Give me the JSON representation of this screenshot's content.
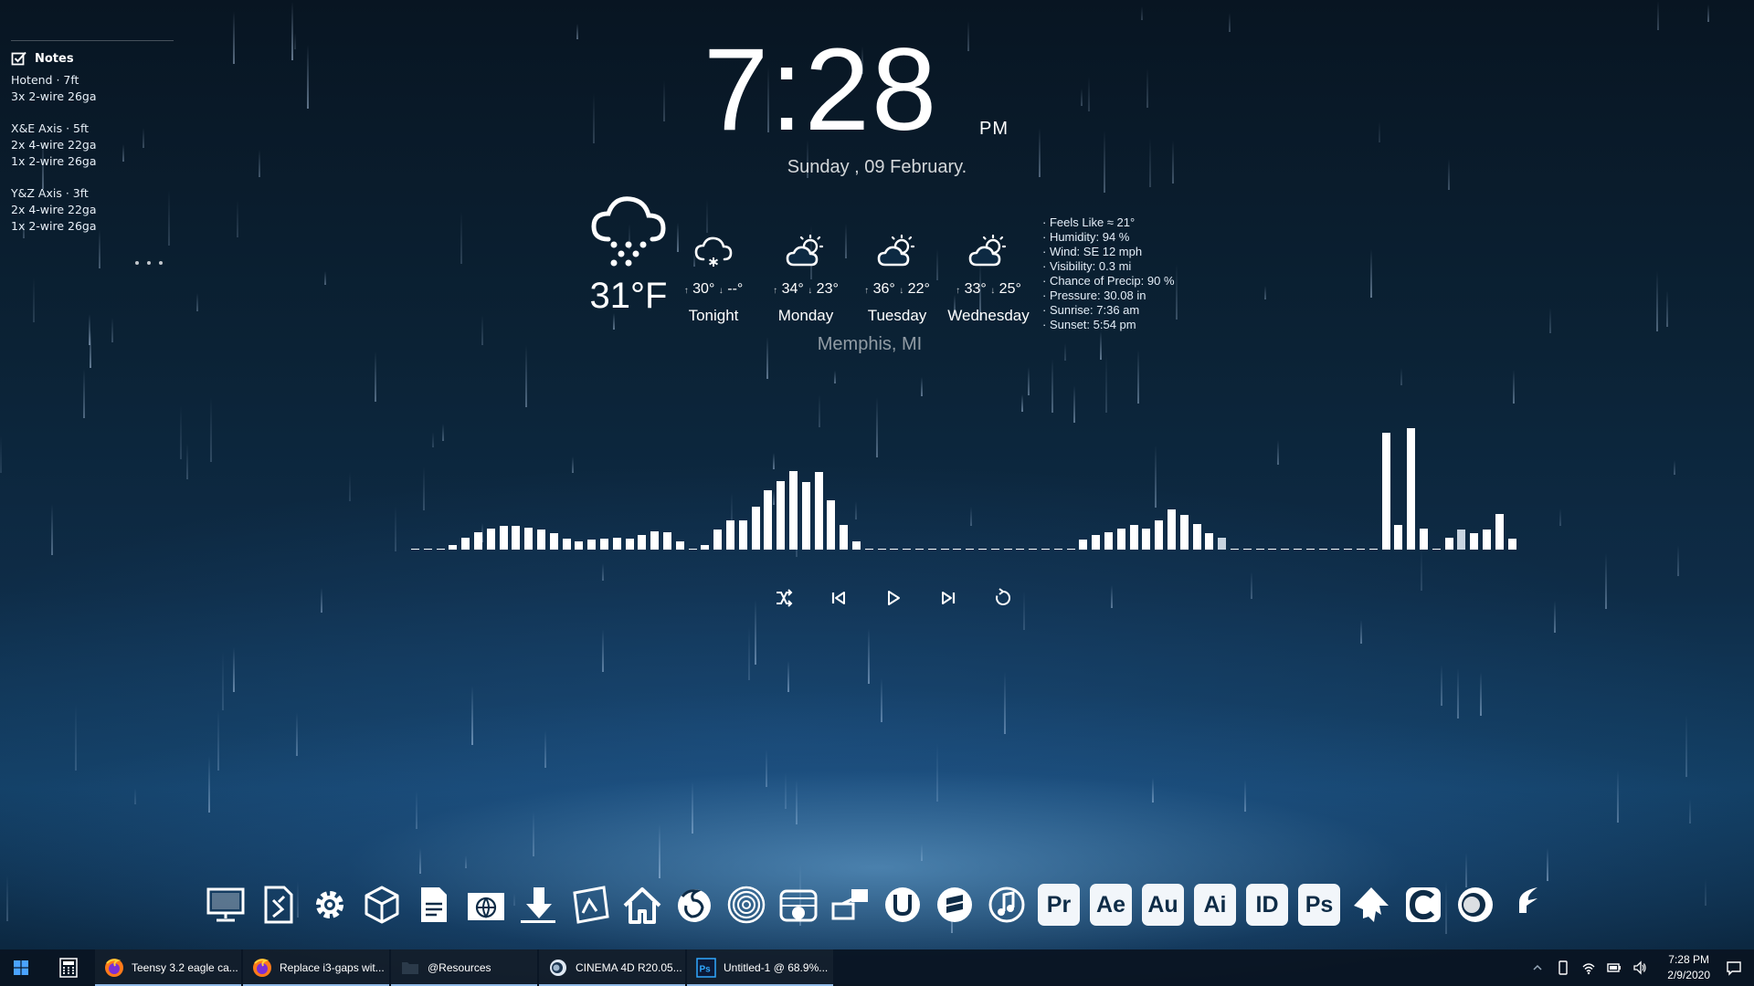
{
  "notes": {
    "title": "Notes",
    "blocks": [
      [
        "Hotend · 7ft",
        "3x 2-wire 26ga"
      ],
      [
        "X&E Axis · 5ft",
        "2x 4-wire 22ga",
        "1x 2-wire 26ga"
      ],
      [
        "Y&Z Axis · 3ft",
        "2x 4-wire 22ga",
        "1x 2-wire 26ga"
      ]
    ]
  },
  "clock": {
    "time": "7:28",
    "ampm": "PM",
    "date": "Sunday , 09 February."
  },
  "weather": {
    "current_temp": "31°F",
    "current_icon": "snow-cloud-icon",
    "forecast": [
      {
        "label": "Tonight",
        "high": "30°",
        "low": "--°",
        "icon": "snow-cloud-icon"
      },
      {
        "label": "Monday",
        "high": "34°",
        "low": "23°",
        "icon": "partly-cloudy-icon"
      },
      {
        "label": "Tuesday",
        "high": "36°",
        "low": "22°",
        "icon": "partly-cloudy-icon"
      },
      {
        "label": "Wednesday",
        "high": "33°",
        "low": "25°",
        "icon": "partly-cloudy-icon"
      }
    ],
    "city": "Memphis, MI",
    "details": [
      "· Feels Like ≈ 21°",
      "· Humidity: 94 %",
      "· Wind: SE 12 mph",
      "· Visibility: 0.3 mi",
      "· Chance of Precip: 90 %",
      "· Pressure: 30.08 in",
      "· Sunrise: 7:36 am",
      "· Sunset: 5:54 pm"
    ]
  },
  "visualizer": {
    "max": 95,
    "levels": [
      1,
      1,
      1,
      4,
      10,
      14,
      17,
      19,
      19,
      18,
      16,
      13,
      9,
      7,
      8,
      9,
      10,
      9,
      12,
      15,
      14,
      7,
      1,
      4,
      16,
      24,
      24,
      35,
      48,
      56,
      64,
      55,
      63,
      40,
      20,
      7,
      1,
      0,
      1,
      1,
      0,
      0,
      0,
      0,
      0,
      1,
      0,
      0,
      0,
      1,
      1,
      1,
      1,
      8,
      12,
      14,
      17,
      20,
      17,
      24,
      33,
      28,
      21,
      13,
      10,
      1,
      1,
      1,
      1,
      1,
      1,
      1,
      1,
      1,
      1,
      0,
      1,
      95,
      20,
      99,
      17,
      1,
      10,
      16,
      13,
      16,
      29,
      9
    ]
  },
  "media": {
    "icons": [
      "shuffle-icon",
      "previous-icon",
      "play-icon",
      "next-icon",
      "repeat-icon"
    ]
  },
  "dock": {
    "icons": [
      "this-pc-icon",
      "file-editor-icon",
      "settings-icon",
      "cube-3d-icon",
      "documents-icon",
      "browser-folder-icon",
      "downloads-icon",
      "pictures-icon",
      "home-icon",
      "firefox-icon",
      "fingerprint-icon",
      "crypto-wallet-icon",
      "network-graph-icon",
      "utorrent-icon",
      "sublime-icon",
      "music-player-icon",
      "premiere-icon",
      "after-effects-icon",
      "audition-icon",
      "illustrator-icon",
      "indesign-icon",
      "photoshop-icon",
      "inkscape-icon",
      "ccleaner-icon",
      "cinema4d-icon",
      "feather-icon"
    ],
    "text_labels": {
      "premiere": "Pr",
      "after_effects": "Ae",
      "audition": "Au",
      "illustrator": "Ai",
      "indesign": "ID",
      "photoshop": "Ps"
    }
  },
  "taskbar": {
    "apps": [
      {
        "title": "Teensy 3.2 eagle ca...",
        "icon": "firefox-icon"
      },
      {
        "title": "Replace i3-gaps wit...",
        "icon": "firefox-icon"
      },
      {
        "title": "@Resources",
        "icon": "folder-icon"
      },
      {
        "title": "CINEMA 4D R20.05...",
        "icon": "cinema4d-icon"
      },
      {
        "title": "Untitled-1 @ 68.9%...",
        "icon": "photoshop-icon"
      }
    ],
    "tray_time": "7:28 PM",
    "tray_date": "2/9/2020"
  },
  "colors": {
    "bg_top": "#081522",
    "bg_glow": "#78b9eb",
    "accent": "#8fb9e6"
  }
}
